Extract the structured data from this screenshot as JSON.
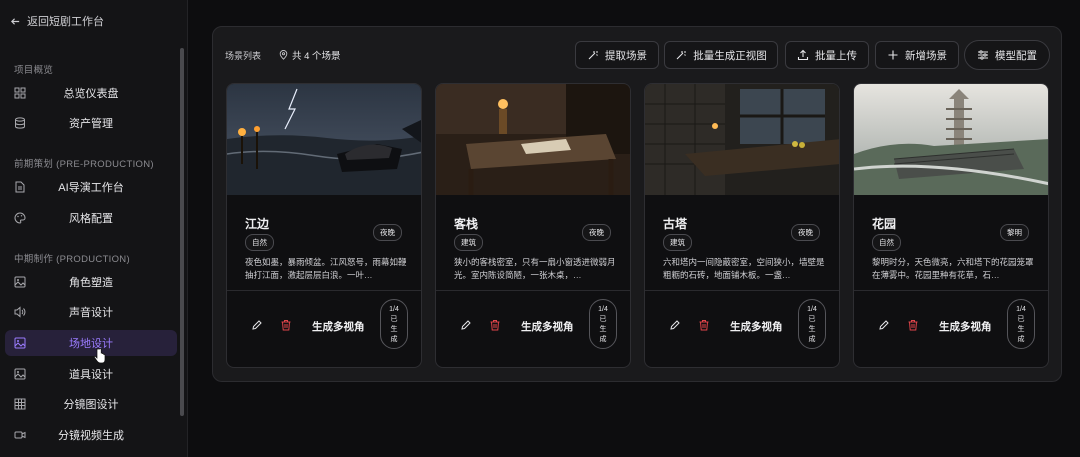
{
  "sidebar": {
    "back": "返回短剧工作台",
    "sections": [
      "项目概览",
      "前期策划 (PRE-PRODUCTION)",
      "中期制作 (PRODUCTION)"
    ],
    "items": [
      {
        "label": "总览仪表盘",
        "icon": "dashboard-icon"
      },
      {
        "label": "资产管理",
        "icon": "database-icon"
      },
      {
        "label": "AI导演工作台",
        "icon": "document-icon"
      },
      {
        "label": "风格配置",
        "icon": "palette-icon"
      },
      {
        "label": "角色塑造",
        "icon": "image-icon"
      },
      {
        "label": "声音设计",
        "icon": "speaker-icon"
      },
      {
        "label": "场地设计",
        "icon": "image-icon",
        "active": true
      },
      {
        "label": "道具设计",
        "icon": "image-icon"
      },
      {
        "label": "分镜图设计",
        "icon": "grid-icon"
      },
      {
        "label": "分镜视频生成",
        "icon": "video-icon"
      }
    ]
  },
  "panel": {
    "title": "场景列表",
    "count": "共 4 个场景",
    "buttons": [
      "提取场景",
      "批量生成正视图",
      "批量上传",
      "新增场景",
      "模型配置"
    ]
  },
  "cards": [
    {
      "name": "江边",
      "category": "自然",
      "time": "夜晚",
      "desc": "夜色如墨，暴雨倾盆。江风怒号，雨幕如鞭抽打江面，激起层层白浪。一叶…",
      "gen": "生成多视角",
      "p1": "1/4",
      "p2": "已",
      "p3": "生",
      "p4": "成"
    },
    {
      "name": "客栈",
      "category": "建筑",
      "time": "夜晚",
      "desc": "狭小的客栈密室，只有一扇小窗透进微弱月光。室内陈设简陋，一张木桌，…",
      "gen": "生成多视角",
      "p1": "1/4",
      "p2": "已",
      "p3": "生",
      "p4": "成"
    },
    {
      "name": "古塔",
      "category": "建筑",
      "time": "夜晚",
      "desc": "六和塔内一间隐蔽密室，空间狭小，墙壁是粗粝的石砖，地面铺木板。一盏…",
      "gen": "生成多视角",
      "p1": "1/4",
      "p2": "已",
      "p3": "生",
      "p4": "成"
    },
    {
      "name": "花园",
      "category": "自然",
      "time": "黎明",
      "desc": "黎明时分，天色微亮，六和塔下的花园笼罩在薄雾中。花园里种有花草，石…",
      "gen": "生成多视角",
      "p1": "1/4",
      "p2": "已",
      "p3": "生",
      "p4": "成"
    }
  ],
  "colors": {
    "accent": "#9b7cff",
    "danger": "#e0444a"
  }
}
